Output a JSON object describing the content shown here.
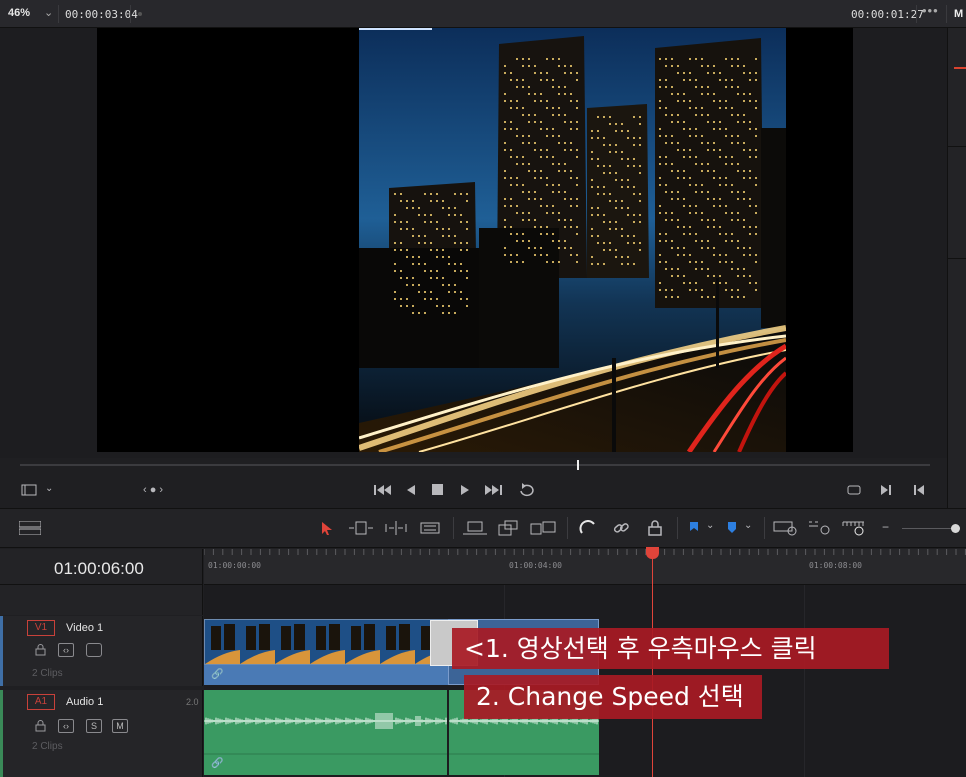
{
  "viewer": {
    "zoom": "46%",
    "source_timecode": "00:00:03:04",
    "duration_timecode": "00:00:01:27",
    "right_label": "M"
  },
  "timeline": {
    "current_timecode": "01:00:06:00",
    "ruler_labels": [
      "01:00:00:00",
      "01:00:04:00",
      "01:00:08:00"
    ]
  },
  "tracks": {
    "video": {
      "badge": "V1",
      "name": "Video 1",
      "clips": "2 Clips"
    },
    "audio": {
      "badge": "A1",
      "name": "Audio 1",
      "level": "2.0",
      "clips": "2 Clips",
      "solo": "S",
      "mute": "M"
    }
  },
  "annotations": {
    "step1": "<1. 영상선택 후 우측마우스 클릭",
    "step2": "2. Change Speed 선택"
  },
  "colors": {
    "playhead": "#e0443a",
    "video_clip": "#4a7ab5",
    "audio_clip": "#3a9a62",
    "annotation_bg": "#a81a24"
  },
  "icons": {
    "transport": [
      "first-frame-icon",
      "play-reverse-icon",
      "stop-icon",
      "play-icon",
      "last-frame-icon",
      "loop-icon"
    ],
    "edit_tools": [
      "selection-arrow-icon",
      "trim-edit-icon",
      "dynamic-trim-icon",
      "blade-icon",
      "overwrite-icon",
      "replace-icon",
      "ripple-overwrite-icon",
      "snapping-icon",
      "link-icon",
      "lock-icon",
      "flag-icon",
      "marker-icon",
      "zoom-full-icon",
      "zoom-detail-icon",
      "zoom-custom-icon"
    ]
  }
}
